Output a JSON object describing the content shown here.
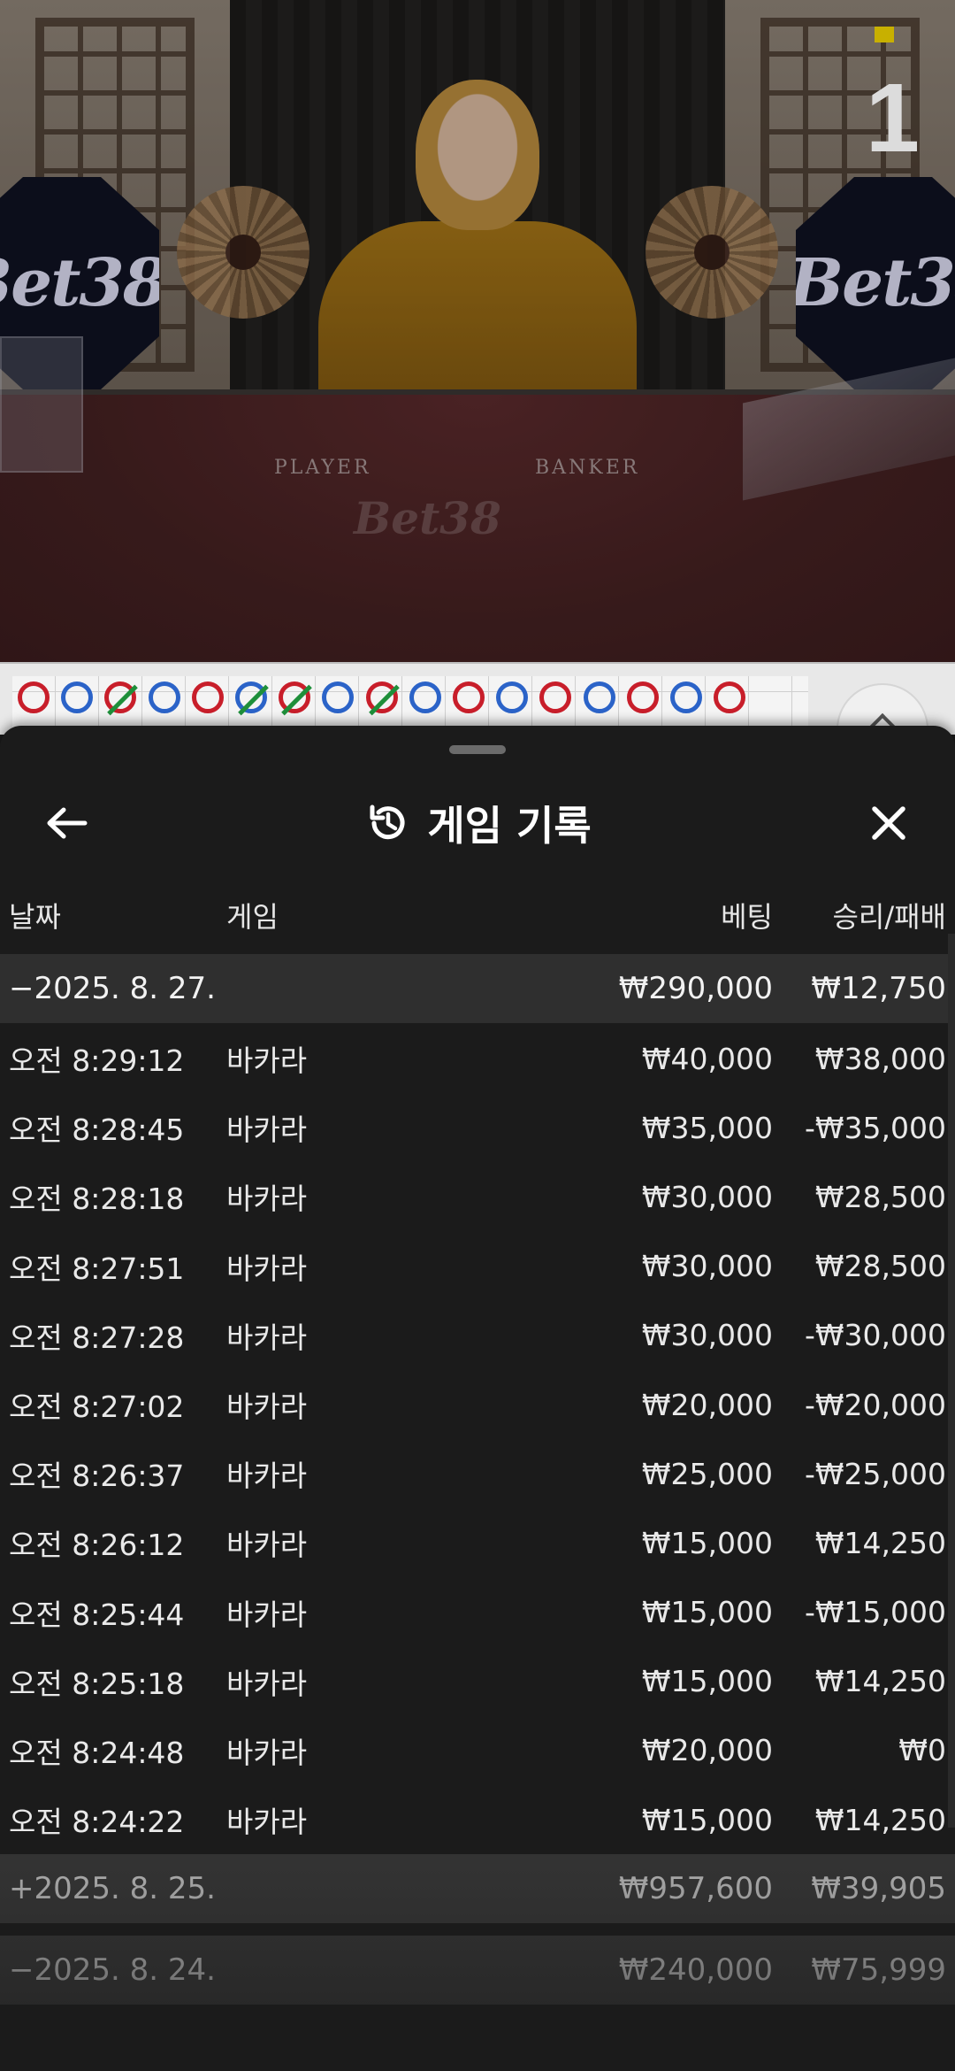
{
  "video": {
    "brand_left": "Bet38",
    "brand_right": "Bet38",
    "table_logo": "Bet38",
    "player_label": "PLAYER",
    "banker_label": "BANKER",
    "round_number": "1"
  },
  "road": {
    "beads": [
      {
        "color": "red",
        "tie": false
      },
      {
        "color": "blue",
        "tie": false
      },
      {
        "color": "red",
        "tie": true
      },
      {
        "color": "blue",
        "tie": false
      },
      {
        "color": "red",
        "tie": false
      },
      {
        "color": "blue",
        "tie": true
      },
      {
        "color": "red",
        "tie": true
      },
      {
        "color": "blue",
        "tie": false
      },
      {
        "color": "red",
        "tie": true
      },
      {
        "color": "blue",
        "tie": false
      },
      {
        "color": "red",
        "tie": false
      },
      {
        "color": "blue",
        "tie": false
      },
      {
        "color": "red",
        "tie": false
      },
      {
        "color": "blue",
        "tie": false
      },
      {
        "color": "red",
        "tie": false
      },
      {
        "color": "blue",
        "tie": false
      },
      {
        "color": "red",
        "tie": false
      }
    ]
  },
  "sheet": {
    "title": "게임 기록",
    "icons": {
      "back": "arrow-left-icon",
      "history": "history-icon",
      "close": "close-icon"
    }
  },
  "history": {
    "headers": {
      "date": "날짜",
      "game": "게임",
      "bet": "베팅",
      "win_loss": "승리/패배"
    },
    "groups": [
      {
        "date": "−2025. 8. 27.",
        "bet": "₩290,000",
        "win_loss": "₩12,750",
        "expanded": true,
        "rows": [
          {
            "time": "오전 8:29:12",
            "game": "바카라",
            "bet": "₩40,000",
            "win_loss": "₩38,000"
          },
          {
            "time": "오전 8:28:45",
            "game": "바카라",
            "bet": "₩35,000",
            "win_loss": "-₩35,000"
          },
          {
            "time": "오전 8:28:18",
            "game": "바카라",
            "bet": "₩30,000",
            "win_loss": "₩28,500"
          },
          {
            "time": "오전 8:27:51",
            "game": "바카라",
            "bet": "₩30,000",
            "win_loss": "₩28,500"
          },
          {
            "time": "오전 8:27:28",
            "game": "바카라",
            "bet": "₩30,000",
            "win_loss": "-₩30,000"
          },
          {
            "time": "오전 8:27:02",
            "game": "바카라",
            "bet": "₩20,000",
            "win_loss": "-₩20,000"
          },
          {
            "time": "오전 8:26:37",
            "game": "바카라",
            "bet": "₩25,000",
            "win_loss": "-₩25,000"
          },
          {
            "time": "오전 8:26:12",
            "game": "바카라",
            "bet": "₩15,000",
            "win_loss": "₩14,250"
          },
          {
            "time": "오전 8:25:44",
            "game": "바카라",
            "bet": "₩15,000",
            "win_loss": "-₩15,000"
          },
          {
            "time": "오전 8:25:18",
            "game": "바카라",
            "bet": "₩15,000",
            "win_loss": "₩14,250"
          },
          {
            "time": "오전 8:24:48",
            "game": "바카라",
            "bet": "₩20,000",
            "win_loss": "₩0"
          },
          {
            "time": "오전 8:24:22",
            "game": "바카라",
            "bet": "₩15,000",
            "win_loss": "₩14,250"
          }
        ]
      },
      {
        "date": "+2025. 8. 25.",
        "bet": "₩957,600",
        "win_loss": "₩39,905",
        "expanded": false,
        "rows": []
      },
      {
        "date": "−2025. 8. 24.",
        "bet": "₩240,000",
        "win_loss": "₩75,999",
        "expanded": false,
        "rows": []
      }
    ]
  }
}
